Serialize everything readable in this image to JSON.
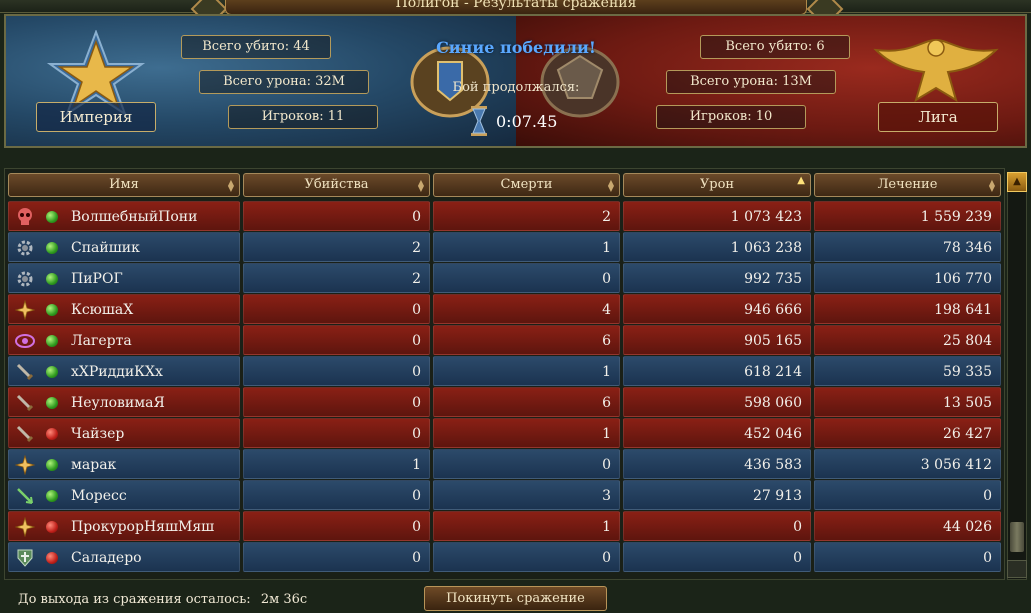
{
  "window": {
    "title": "Полигон - Результаты сражения"
  },
  "blue_team": {
    "name": "Империя",
    "kills": "Всего убито: 44",
    "damage": "Всего урона: 32M",
    "players": "Игроков: 11",
    "emblem": "gold-star-icon"
  },
  "red_team": {
    "name": "Лига",
    "kills": "Всего убито: 6",
    "damage": "Всего урона: 13M",
    "players": "Игроков: 10",
    "emblem": "gold-eagle-icon"
  },
  "result": {
    "winner_text": "Синие победили!",
    "duration_label": "Бой продолжался:",
    "duration": "0:07.45"
  },
  "table": {
    "columns": [
      "Имя",
      "Убийства",
      "Смерти",
      "Урон",
      "Лечение"
    ],
    "sorted_column": "Урон",
    "rows": [
      {
        "icon": "skull-icon",
        "online": true,
        "team": "red",
        "name": "ВолшебныйПони",
        "kills": "0",
        "deaths": "2",
        "damage": "1 073 423",
        "healing": "1 559 239"
      },
      {
        "icon": "gear-icon",
        "online": true,
        "team": "blue",
        "name": "Спайшик",
        "kills": "2",
        "deaths": "1",
        "damage": "1 063 238",
        "healing": "78 346"
      },
      {
        "icon": "gear-icon",
        "online": true,
        "team": "blue",
        "name": "ПиРОГ",
        "kills": "2",
        "deaths": "0",
        "damage": "992 735",
        "healing": "106 770"
      },
      {
        "icon": "cross-icon",
        "online": true,
        "team": "red",
        "name": "КсюшаХ",
        "kills": "0",
        "deaths": "4",
        "damage": "946 666",
        "healing": "198 641"
      },
      {
        "icon": "eye-icon",
        "online": true,
        "team": "red",
        "name": "Лагерта",
        "kills": "0",
        "deaths": "6",
        "damage": "905 165",
        "healing": "25 804"
      },
      {
        "icon": "sword-icon",
        "online": true,
        "team": "blue",
        "name": "хХРиддиКХх",
        "kills": "0",
        "deaths": "1",
        "damage": "618 214",
        "healing": "59 335"
      },
      {
        "icon": "sword-icon",
        "online": true,
        "team": "red",
        "name": "НеуловимаЯ",
        "kills": "0",
        "deaths": "6",
        "damage": "598 060",
        "healing": "13 505"
      },
      {
        "icon": "sword-icon",
        "online": false,
        "team": "red",
        "name": "Чайзер",
        "kills": "0",
        "deaths": "1",
        "damage": "452 046",
        "healing": "26 427"
      },
      {
        "icon": "cross-icon",
        "online": true,
        "team": "blue",
        "name": "марак",
        "kills": "1",
        "deaths": "0",
        "damage": "436 583",
        "healing": "3 056 412"
      },
      {
        "icon": "arrow-icon",
        "online": true,
        "team": "blue",
        "name": "Моресс",
        "kills": "0",
        "deaths": "3",
        "damage": "27 913",
        "healing": "0"
      },
      {
        "icon": "cross-icon",
        "online": false,
        "team": "red",
        "name": "ПрокурорНяшМяш",
        "kills": "0",
        "deaths": "1",
        "damage": "0",
        "healing": "44 026"
      },
      {
        "icon": "shield-icon",
        "online": false,
        "team": "blue",
        "name": "Саладеро",
        "kills": "0",
        "deaths": "0",
        "damage": "0",
        "healing": "0"
      }
    ]
  },
  "footer": {
    "exit_label": "До выхода из сражения осталось:",
    "exit_time": "2м 36с",
    "leave_button": "Покинуть сражение"
  }
}
